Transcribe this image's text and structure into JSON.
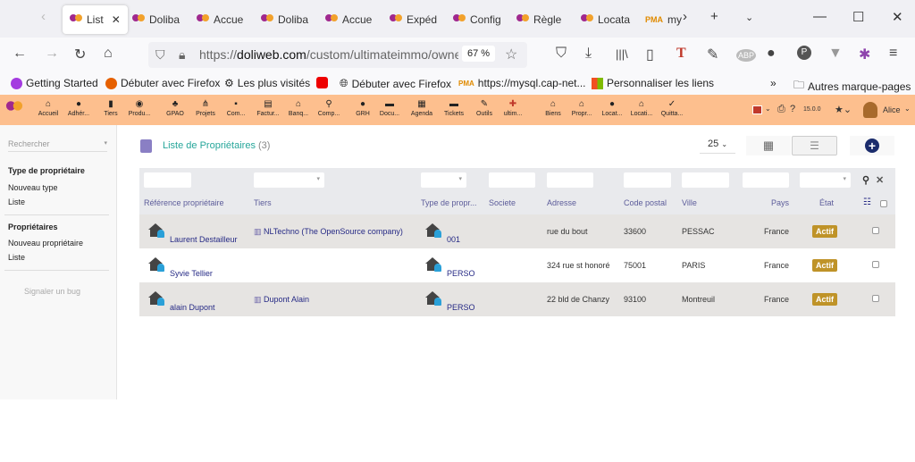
{
  "browser": {
    "tabs": [
      {
        "label": "List",
        "active": true
      },
      {
        "label": "Doliba"
      },
      {
        "label": "Accue"
      },
      {
        "label": "Doliba"
      },
      {
        "label": "Accue"
      },
      {
        "label": "Expéd"
      },
      {
        "label": "Config"
      },
      {
        "label": "Règle"
      },
      {
        "label": "Locata"
      },
      {
        "label": "my"
      }
    ],
    "url_prefix": "https://",
    "url_domain": "doliweb.com",
    "url_path": "/custom/ultimateimmo/owner",
    "zoom": "67 %",
    "bookmarks": [
      "Getting Started",
      "Débuter avec Firefox",
      "Les plus visités",
      "Débuter avec Firefox",
      "https://mysql.cap-net...",
      "Personnaliser les liens"
    ],
    "other_bookmarks": "Autres marque-pages"
  },
  "menu": {
    "items": [
      "Accueil",
      "Adhér...",
      "Tiers",
      "Produ...",
      "GPAO",
      "Projets",
      "Com...",
      "Factur...",
      "Banq...",
      "Comp...",
      "GRH",
      "Docu...",
      "Agenda",
      "Tickets",
      "Outils",
      "ultim...",
      "Biens",
      "Propr...",
      "Locat...",
      "Locati...",
      "Quitta..."
    ],
    "version": "15.0.0",
    "user": "Alice"
  },
  "sidebar": {
    "search_placeholder": "Rechercher",
    "section1": {
      "title": "Type de propriétaire",
      "items": [
        "Nouveau type",
        "Liste"
      ]
    },
    "section2": {
      "title": "Propriétaires",
      "items": [
        "Nouveau propriétaire",
        "Liste"
      ]
    },
    "bug": "Signaler un bug"
  },
  "main": {
    "title": "Liste de Propriétaires",
    "count": "(3)",
    "page_size": "25",
    "columns": [
      "Référence propriétaire",
      "Tiers",
      "Type de propr...",
      "Societe",
      "Adresse",
      "Code postal",
      "Ville",
      "Pays",
      "État"
    ],
    "rows": [
      {
        "ref": "Laurent Destailleur",
        "tiers": "NLTechno (The OpenSource company)",
        "type": "001",
        "societe": "",
        "adresse": "rue du bout",
        "cp": "33600",
        "ville": "PESSAC",
        "pays": "France",
        "etat": "Actif"
      },
      {
        "ref": "Syvie Tellier",
        "tiers": "",
        "type": "PERSO",
        "societe": "",
        "adresse": "324 rue st honoré",
        "cp": "75001",
        "ville": "PARIS",
        "pays": "France",
        "etat": "Actif"
      },
      {
        "ref": "alain Dupont",
        "tiers": "Dupont Alain",
        "type": "PERSO",
        "societe": "",
        "adresse": "22 bld de Chanzy",
        "cp": "93100",
        "ville": "Montreuil",
        "pays": "France",
        "etat": "Actif"
      }
    ]
  },
  "colors": {
    "menu_bg": "#fdbf8e",
    "title": "#26a69a",
    "link": "#262a85",
    "badge": "#bf9328"
  }
}
